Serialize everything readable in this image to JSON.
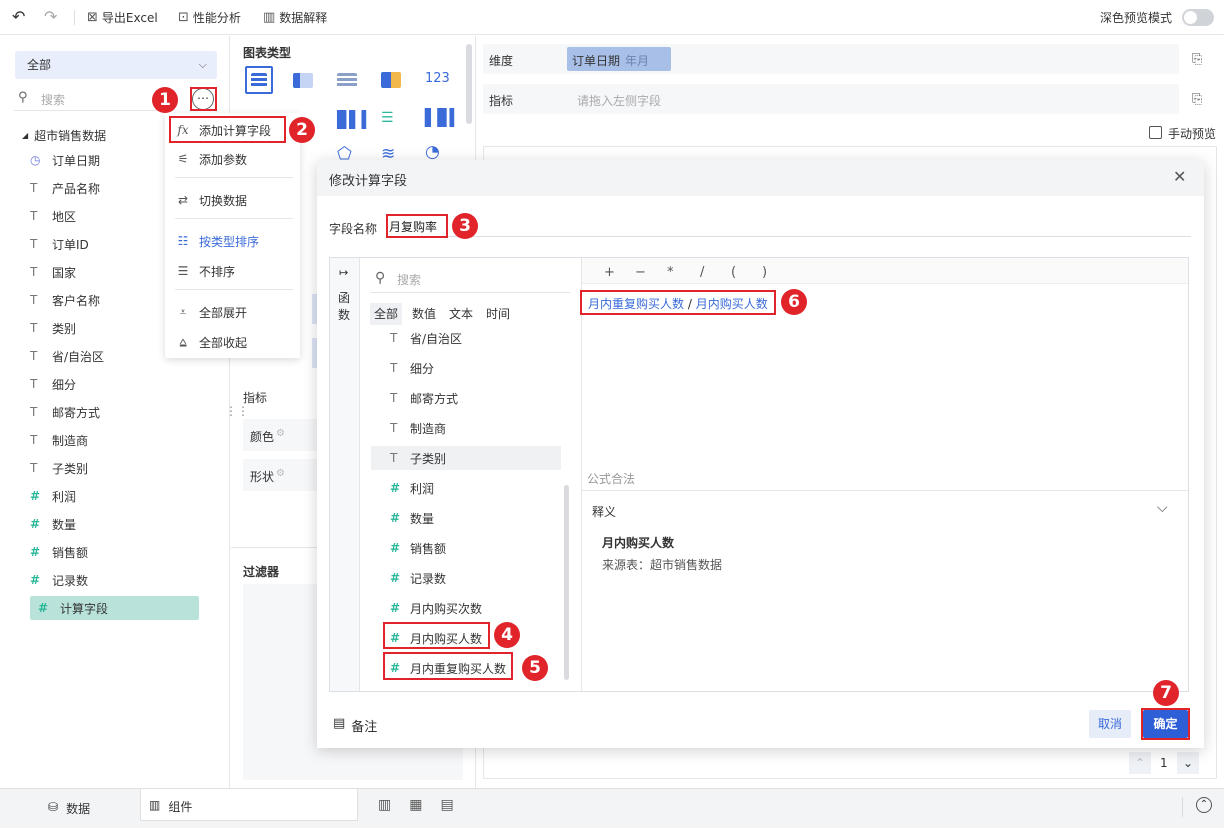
{
  "toolbar": {
    "undo": "↶",
    "redo": "↷",
    "export_excel": "导出Excel",
    "perf_analysis": "性能分析",
    "data_explain": "数据解释",
    "dark_preview": "深色预览模式"
  },
  "left": {
    "select_value": "全部",
    "search_placeholder": "搜索",
    "dataset": "超市销售数据",
    "fields": [
      {
        "type": "date",
        "label": "订单日期"
      },
      {
        "type": "text",
        "label": "产品名称"
      },
      {
        "type": "text",
        "label": "地区"
      },
      {
        "type": "text",
        "label": "订单ID"
      },
      {
        "type": "text",
        "label": "国家"
      },
      {
        "type": "text",
        "label": "客户名称"
      },
      {
        "type": "text",
        "label": "类别"
      },
      {
        "type": "text",
        "label": "省/自治区"
      },
      {
        "type": "text",
        "label": "细分"
      },
      {
        "type": "text",
        "label": "邮寄方式"
      },
      {
        "type": "text",
        "label": "制造商"
      },
      {
        "type": "text",
        "label": "子类别"
      },
      {
        "type": "number",
        "label": "利润"
      },
      {
        "type": "number",
        "label": "数量"
      },
      {
        "type": "number",
        "label": "销售额"
      },
      {
        "type": "number",
        "label": "记录数"
      },
      {
        "type": "calc",
        "label": "计算字段"
      }
    ]
  },
  "menu": {
    "items": [
      "添加计算字段",
      "添加参数",
      "切换数据",
      "按类型排序",
      "不排序",
      "全部展开",
      "全部收起"
    ]
  },
  "mid": {
    "chart_type_title": "图表类型",
    "metric_label": "指标",
    "color_label": "颜色",
    "shape_label": "形状",
    "filter_label": "过滤器",
    "num_icon_text": "123"
  },
  "right": {
    "dimension_label": "维度",
    "dimension_chip": "订单日期",
    "dimension_chip_sub": "年月",
    "metric_label": "指标",
    "metric_placeholder": "请拖入左侧字段",
    "manual_preview": "手动预览",
    "page_num": "1"
  },
  "dialog": {
    "title": "修改计算字段",
    "field_name_label": "字段名称",
    "field_name_value": "月复购率",
    "func_tab": "函数",
    "search_placeholder": "搜索",
    "categories": [
      "全部",
      "数值",
      "文本",
      "时间"
    ],
    "field_list": [
      {
        "type": "text",
        "label": "省/自治区"
      },
      {
        "type": "text",
        "label": "细分"
      },
      {
        "type": "text",
        "label": "邮寄方式"
      },
      {
        "type": "text",
        "label": "制造商"
      },
      {
        "type": "text",
        "label": "子类别"
      },
      {
        "type": "number",
        "label": "利润"
      },
      {
        "type": "number",
        "label": "数量"
      },
      {
        "type": "number",
        "label": "销售额"
      },
      {
        "type": "number",
        "label": "记录数"
      },
      {
        "type": "calc",
        "label": "月内购买次数"
      },
      {
        "type": "calc",
        "label": "月内购买人数"
      },
      {
        "type": "calc",
        "label": "月内重复购买人数"
      }
    ],
    "operators": [
      "+",
      "−",
      "*",
      "/",
      "(",
      ")"
    ],
    "formula_part1": "月内重复购买人数",
    "formula_op": " / ",
    "formula_part2": "月内购买人数",
    "formula_status": "公式合法",
    "desc_title": "释义",
    "desc_field": "月内购买人数",
    "desc_source": "来源表：超市销售数据",
    "note": "备注",
    "cancel": "取消",
    "confirm": "确定"
  },
  "bottom": {
    "data_tab": "数据",
    "component_tab": "组件"
  },
  "badges": [
    "1",
    "2",
    "3",
    "4",
    "5",
    "6",
    "7"
  ],
  "colors": {
    "accent": "#3a6bd8",
    "confirm_bg": "#2f5fd6",
    "badge_red": "#e0242a",
    "number_icon": "#2bb79b",
    "calc_chip": "#b9e3da"
  }
}
